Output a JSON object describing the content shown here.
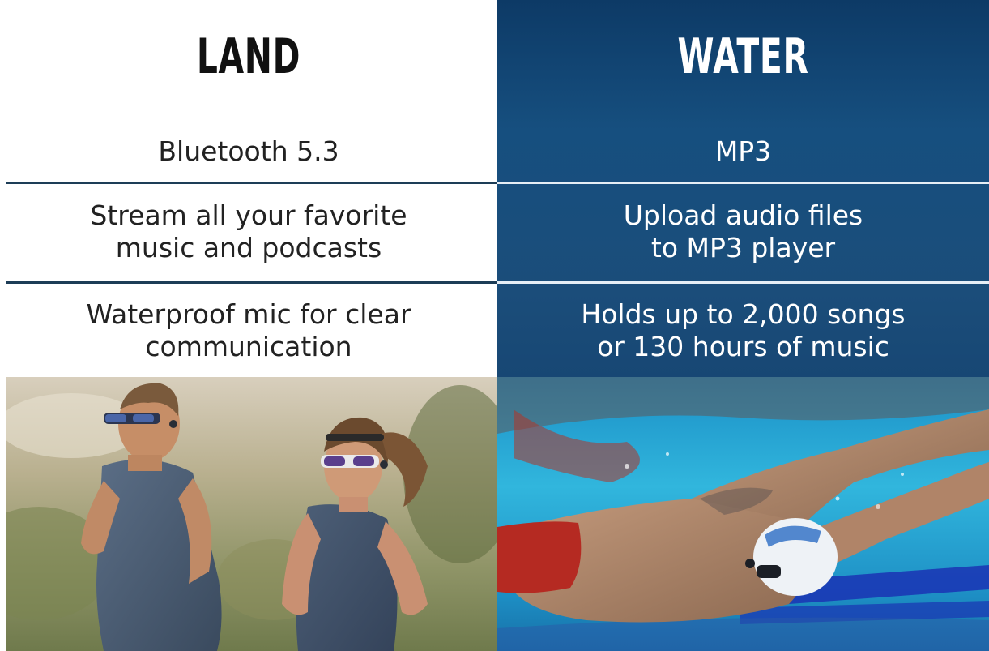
{
  "land": {
    "heading": "LAND",
    "rows": [
      {
        "lines": [
          "Bluetooth 5.3"
        ]
      },
      {
        "lines": [
          "Stream all your favorite",
          "music and podcasts"
        ]
      },
      {
        "lines": [
          "Waterproof mic for clear",
          "communication"
        ]
      }
    ],
    "photo_icon": "runners-photo"
  },
  "water": {
    "heading": "WATER",
    "rows": [
      {
        "lines": [
          "MP3"
        ]
      },
      {
        "lines": [
          "Upload audio files",
          "to MP3 player"
        ]
      },
      {
        "lines": [
          "Holds up to 2,000 songs",
          "or 130 hours of music"
        ]
      }
    ],
    "photo_icon": "swimmer-photo"
  },
  "colors": {
    "water_panel": "#164f7f",
    "land_panel": "#ffffff",
    "divider_dark": "#1d3d57",
    "divider_light": "#e6eef6"
  }
}
